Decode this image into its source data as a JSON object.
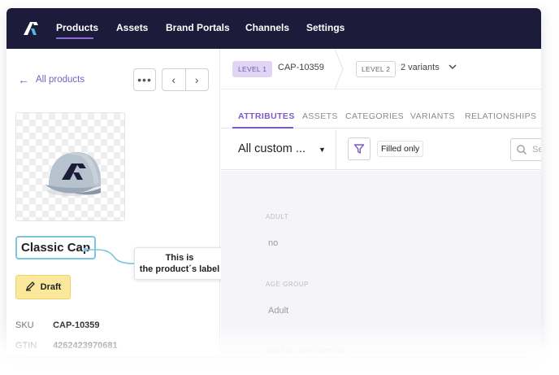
{
  "app": {
    "colors": {
      "nav_bg": "#1d1b3a",
      "accent": "#7a5cc4",
      "draft_bg": "#fbe89a",
      "label_border": "#7cc6df"
    }
  },
  "topnav": {
    "logo_icon": "brand-logo-icon",
    "items": [
      {
        "label": "Products",
        "active": true
      },
      {
        "label": "Assets",
        "active": false
      },
      {
        "label": "Brand Portals",
        "active": false
      },
      {
        "label": "Channels",
        "active": false
      },
      {
        "label": "Settings",
        "active": false
      }
    ]
  },
  "sidebar": {
    "back_label": "All products",
    "back_icon": "arrow-left-icon",
    "more_icon": "more-dots-icon",
    "more_glyph": "•••",
    "prev_icon": "chevron-left-icon",
    "prev_glyph": "‹",
    "next_icon": "chevron-right-icon",
    "next_glyph": "›",
    "product_image": "baseball-cap-image",
    "product_label": "Classic Cap",
    "callout_line1": "This is",
    "callout_line2": "the product´s label",
    "status_label": "Draft",
    "status_icon": "pencil-icon",
    "sku_key": "SKU",
    "sku_value": "CAP-10359",
    "gtin_key": "GTIN",
    "gtin_value": "4262423970681"
  },
  "breadcrumb": {
    "level1_badge": "LEVEL 1",
    "level1_code": "CAP-10359",
    "level2_badge": "LEVEL 2",
    "level2_text": "2 variants",
    "dropdown_icon": "chevron-down-icon",
    "dropdown_glyph": "⌄"
  },
  "tabs": [
    {
      "label": "ATTRIBUTES",
      "active": true
    },
    {
      "label": "ASSETS",
      "active": false
    },
    {
      "label": "CATEGORIES",
      "active": false
    },
    {
      "label": "VARIANTS",
      "active": false
    },
    {
      "label": "RELATIONSHIPS",
      "active": false
    }
  ],
  "filter": {
    "selected": "All custom ...",
    "caret_glyph": "▼",
    "funnel_icon": "funnel-icon",
    "filled_only_label": "Filled only",
    "search_icon": "search-icon",
    "search_placeholder": "Se"
  },
  "attributes": [
    {
      "label": "ADULT",
      "value": "no"
    },
    {
      "label": "AGE GROUP",
      "value": "Adult"
    },
    {
      "label": "AMAZON KEY FEATURE 1",
      "value": ""
    }
  ]
}
